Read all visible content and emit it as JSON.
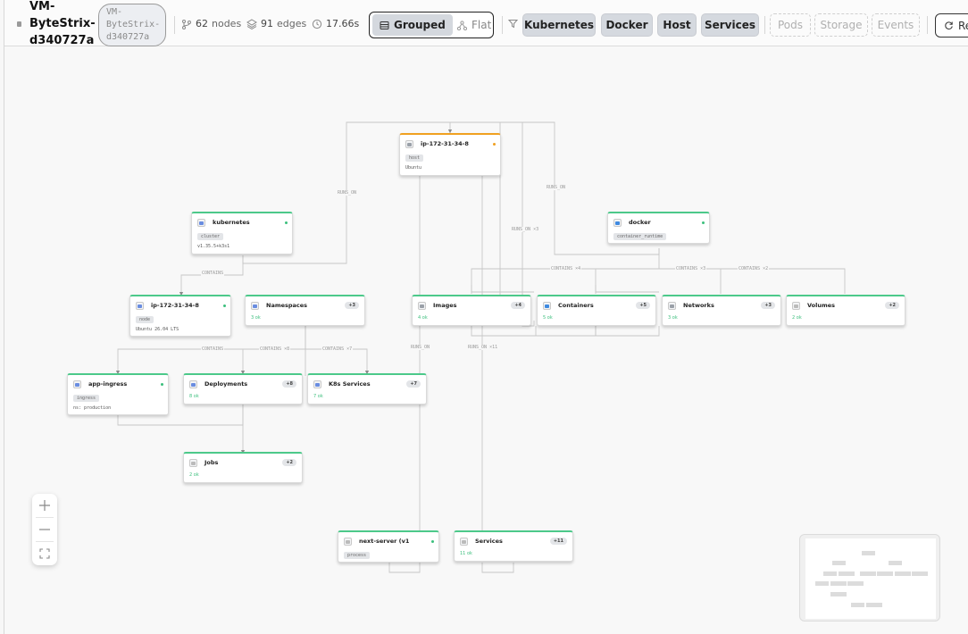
{
  "toolbar": {
    "vm_title": "VM-ByteStrix-d340727a",
    "vm_pill": "VM-ByteStrix-d340727a",
    "nodes_count": "62",
    "nodes_label": "nodes",
    "edges_count": "91",
    "edges_label": "edges",
    "duration": "17.66s",
    "view_grouped": "Grouped",
    "view_flat": "Flat",
    "filters_on": [
      "Kubernetes",
      "Docker",
      "Host",
      "Services"
    ],
    "filters_off": [
      "Pods",
      "Storage",
      "Events"
    ],
    "reset_label": "Re"
  },
  "nodes": {
    "host": {
      "title": "ip-172-31-34-8",
      "badge": "host",
      "sub": "Ubuntu"
    },
    "kubernetes": {
      "title": "kubernetes",
      "badge": "cluster",
      "sub": "v1.35.5+k3s1"
    },
    "docker": {
      "title": "docker",
      "badge": "container_runtime"
    },
    "k8snode": {
      "title": "ip-172-31-34-8",
      "badge": "node",
      "sub": "Ubuntu 26.04 LTS"
    },
    "namespaces": {
      "title": "Namespaces",
      "count": "+3",
      "ok": "3 ok"
    },
    "images": {
      "title": "Images",
      "count": "+4",
      "ok": "4 ok"
    },
    "containers": {
      "title": "Containers",
      "count": "+5",
      "ok": "5 ok"
    },
    "networks": {
      "title": "Networks",
      "count": "+3",
      "ok": "3 ok"
    },
    "volumes": {
      "title": "Volumes",
      "count": "+2",
      "ok": "2 ok"
    },
    "ingress": {
      "title": "app-ingress",
      "badge": "ingress",
      "sub": "ns: production"
    },
    "deployments": {
      "title": "Deployments",
      "count": "+8",
      "ok": "8 ok"
    },
    "k8sservices": {
      "title": "K8s Services",
      "count": "+7",
      "ok": "7 ok"
    },
    "jobs": {
      "title": "Jobs",
      "count": "+2",
      "ok": "2 ok"
    },
    "nextserver": {
      "title": "next-server (v1",
      "badge": "process"
    },
    "services": {
      "title": "Services",
      "count": "+11",
      "ok": "11 ok"
    }
  },
  "edge_labels": {
    "runs_on_a": "RUNS_ON",
    "runs_on_b": "RUNS_ON",
    "runs_on_3": "RUNS_ON ×3",
    "contains_k": "CONTAINS",
    "contains_4": "CONTAINS ×4",
    "contains_3": "CONTAINS ×3",
    "contains_2": "CONTAINS ×2",
    "contains_n": "CONTAINS",
    "contains_8": "CONTAINS ×8",
    "contains_7": "CONTAINS ×7",
    "runs_on_c": "RUNS_ON",
    "runs_on_11": "RUNS_ON ×11"
  },
  "colors": {
    "ok": "#3cbf7d",
    "warn": "#f0a020",
    "accent": "#d4d8de"
  }
}
